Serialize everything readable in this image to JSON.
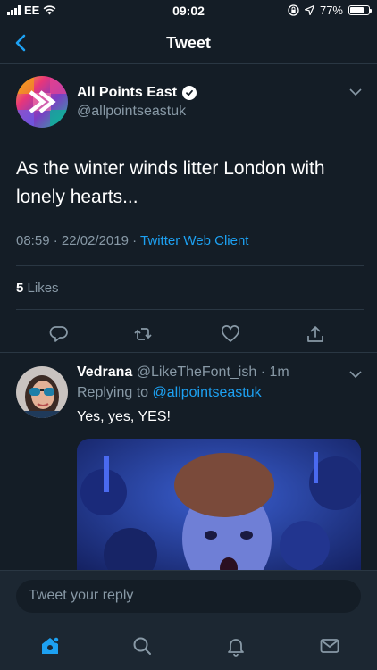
{
  "status": {
    "carrier": "EE",
    "time": "09:02",
    "battery": "77%",
    "battery_level": 0.77
  },
  "nav": {
    "title": "Tweet"
  },
  "tweet": {
    "author_name": "All Points East",
    "author_handle": "@allpointseastuk",
    "text": "As the winter winds litter London with lonely hearts...",
    "time": "08:59",
    "date": "22/02/2019",
    "client": "Twitter Web Client",
    "likes_count": "5",
    "likes_label": "Likes"
  },
  "reply": {
    "author_name": "Vedrana",
    "author_handle": "@LikeTheFont_ish",
    "age": "1m",
    "replying_prefix": "Replying to",
    "replying_to": "@allpointseastuk",
    "text": "Yes, yes, YES!"
  },
  "composer": {
    "placeholder": "Tweet your reply"
  },
  "tabs": [
    "home-icon",
    "search-icon",
    "notifications-icon",
    "messages-icon"
  ],
  "colors": {
    "background": "#141d26",
    "accent": "#1da1f2",
    "muted": "#8899a6",
    "divider": "#2a3743"
  }
}
